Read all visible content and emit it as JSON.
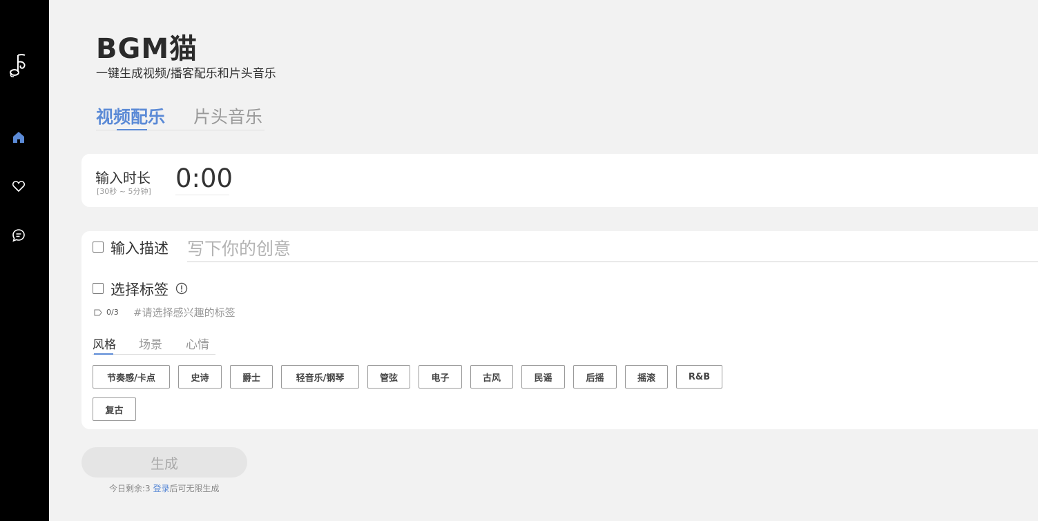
{
  "app": {
    "title": "BGM猫",
    "subtitle": "一键生成视频/播客配乐和片头音乐"
  },
  "sidebar": {
    "items": [
      {
        "icon": "home-icon",
        "active": true
      },
      {
        "icon": "heart-icon",
        "active": false
      },
      {
        "icon": "chat-icon",
        "active": false
      }
    ]
  },
  "tabs": [
    {
      "label": "视频配乐",
      "active": true
    },
    {
      "label": "片头音乐",
      "active": false
    }
  ],
  "duration": {
    "label": "输入时长",
    "hint": "[30秒 ~ 5分钟]",
    "value": "0:00"
  },
  "description": {
    "label": "输入描述",
    "checked": false,
    "placeholder": "写下你的创意"
  },
  "tags": {
    "label": "选择标签",
    "checked": false,
    "count": "0/3",
    "hint": "#请选择感兴趣的标签",
    "categories": [
      {
        "label": "风格",
        "active": true
      },
      {
        "label": "场景",
        "active": false
      },
      {
        "label": "心情",
        "active": false
      }
    ],
    "chips": [
      "节奏感/卡点",
      "史诗",
      "爵士",
      "轻音乐/钢琴",
      "管弦",
      "电子",
      "古风",
      "民谣",
      "后摇",
      "摇滚",
      "R&B",
      "复古"
    ]
  },
  "generate": {
    "label": "生成",
    "remaining_prefix": "今日剩余:3 ",
    "login_label": "登录",
    "remaining_suffix": "后可无限生成"
  },
  "colors": {
    "accent": "#5b8ad6",
    "sidebar_bg": "#000000",
    "page_bg": "#f2f2f2"
  }
}
